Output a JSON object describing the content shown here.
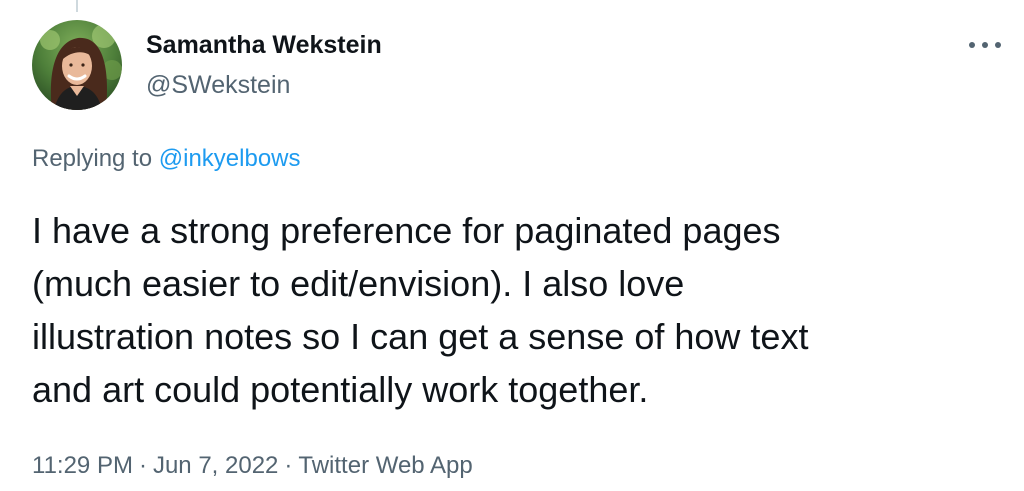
{
  "author": {
    "display_name": "Samantha Wekstein",
    "handle": "@SWekstein"
  },
  "more_icon": "more-dots-icon",
  "reply": {
    "prefix": "Replying to",
    "mention": "@inkyelbows"
  },
  "tweet": {
    "lines": [
      "I have a strong preference for paginated pages",
      "(much easier to edit/envision). I also love",
      "illustration notes so I can get a sense of how text",
      "and art could potentially work together."
    ]
  },
  "meta": {
    "time": "11:29 PM",
    "date": "Jun 7, 2022",
    "source": "Twitter Web App",
    "separator": "·"
  },
  "colors": {
    "text_primary": "#0f1419",
    "text_secondary": "#536471",
    "accent": "#1d9bf0"
  }
}
